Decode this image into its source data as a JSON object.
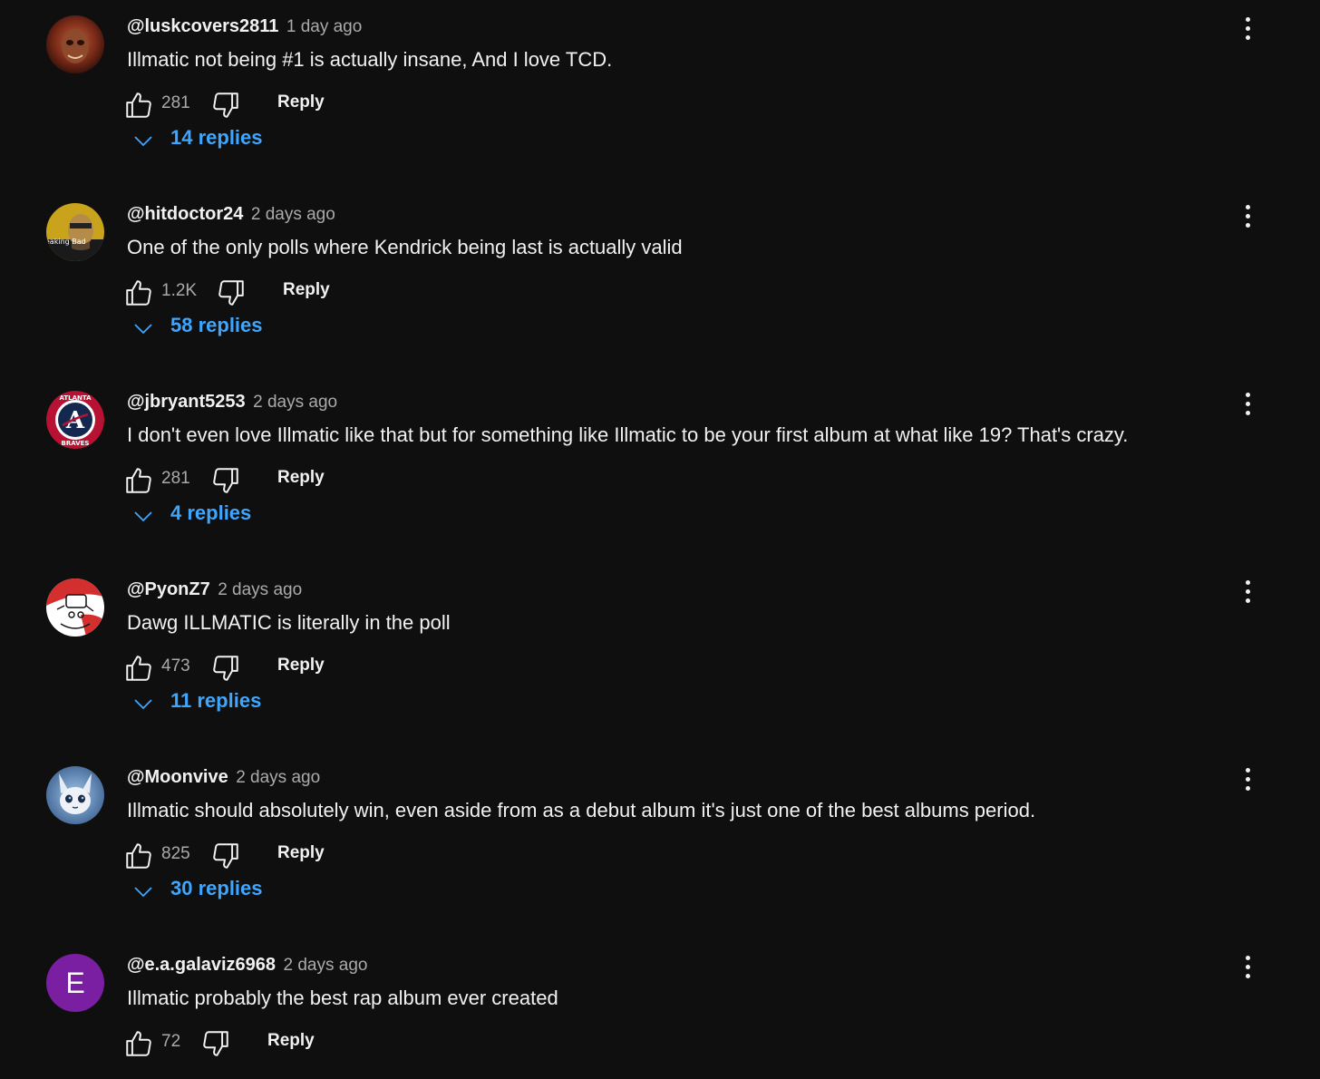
{
  "colors": {
    "background": "#0f0f0f",
    "text": "#f1f1f1",
    "meta": "#aaaaaa",
    "link": "#3ea6ff"
  },
  "comments": [
    {
      "handle": "@luskcovers2811",
      "time": "1 day ago",
      "text": "Illmatic not being #1 is actually insane, And I love TCD.",
      "likes": "281",
      "reply_label": "Reply",
      "replies": "14 replies",
      "avatar_icon": "masked-face-avatar"
    },
    {
      "handle": "@hitdoctor24",
      "time": "2 days ago",
      "text": "One of the only polls where Kendrick being last is actually valid",
      "likes": "1.2K",
      "reply_label": "Reply",
      "replies": "58 replies",
      "avatar_icon": "breaking-bad-avatar",
      "avatar_text": "Breaking Bad"
    },
    {
      "handle": "@jbryant5253",
      "time": "2 days ago",
      "text": "I don't even love Illmatic like that but for something like Illmatic to be your first album at what like 19? That's crazy.",
      "likes": "281",
      "reply_label": "Reply",
      "replies": "4 replies",
      "avatar_icon": "atlanta-braves-logo-avatar",
      "avatar_text_top": "ATLANTA",
      "avatar_text_bottom": "BRAVES"
    },
    {
      "handle": "@PyonZ7",
      "time": "2 days ago",
      "text": "Dawg ILLMATIC is literally in the poll",
      "likes": "473",
      "reply_label": "Reply",
      "replies": "11 replies",
      "avatar_icon": "sketch-character-avatar"
    },
    {
      "handle": "@Moonvive",
      "time": "2 days ago",
      "text": "Illmatic should absolutely win, even aside from as a debut album it's just one of the best albums period.",
      "likes": "825",
      "reply_label": "Reply",
      "replies": "30 replies",
      "avatar_icon": "fox-character-avatar"
    },
    {
      "handle": "@e.a.galaviz6968",
      "time": "2 days ago",
      "text": "Illmatic probably the best rap album ever created",
      "likes": "72",
      "reply_label": "Reply",
      "avatar_icon": "letter-avatar",
      "avatar_letter": "E",
      "avatar_color": "#7b1fa2"
    }
  ]
}
